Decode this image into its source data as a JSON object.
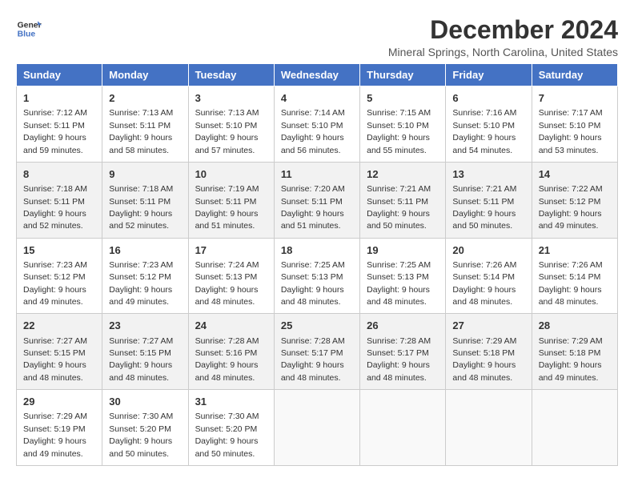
{
  "header": {
    "logo_line1": "General",
    "logo_line2": "Blue",
    "month": "December 2024",
    "location": "Mineral Springs, North Carolina, United States"
  },
  "weekdays": [
    "Sunday",
    "Monday",
    "Tuesday",
    "Wednesday",
    "Thursday",
    "Friday",
    "Saturday"
  ],
  "weeks": [
    [
      {
        "day": 1,
        "sunrise": "7:12 AM",
        "sunset": "5:11 PM",
        "daylight": "9 hours and 59 minutes."
      },
      {
        "day": 2,
        "sunrise": "7:13 AM",
        "sunset": "5:11 PM",
        "daylight": "9 hours and 58 minutes."
      },
      {
        "day": 3,
        "sunrise": "7:13 AM",
        "sunset": "5:10 PM",
        "daylight": "9 hours and 57 minutes."
      },
      {
        "day": 4,
        "sunrise": "7:14 AM",
        "sunset": "5:10 PM",
        "daylight": "9 hours and 56 minutes."
      },
      {
        "day": 5,
        "sunrise": "7:15 AM",
        "sunset": "5:10 PM",
        "daylight": "9 hours and 55 minutes."
      },
      {
        "day": 6,
        "sunrise": "7:16 AM",
        "sunset": "5:10 PM",
        "daylight": "9 hours and 54 minutes."
      },
      {
        "day": 7,
        "sunrise": "7:17 AM",
        "sunset": "5:10 PM",
        "daylight": "9 hours and 53 minutes."
      }
    ],
    [
      {
        "day": 8,
        "sunrise": "7:18 AM",
        "sunset": "5:11 PM",
        "daylight": "9 hours and 52 minutes."
      },
      {
        "day": 9,
        "sunrise": "7:18 AM",
        "sunset": "5:11 PM",
        "daylight": "9 hours and 52 minutes."
      },
      {
        "day": 10,
        "sunrise": "7:19 AM",
        "sunset": "5:11 PM",
        "daylight": "9 hours and 51 minutes."
      },
      {
        "day": 11,
        "sunrise": "7:20 AM",
        "sunset": "5:11 PM",
        "daylight": "9 hours and 51 minutes."
      },
      {
        "day": 12,
        "sunrise": "7:21 AM",
        "sunset": "5:11 PM",
        "daylight": "9 hours and 50 minutes."
      },
      {
        "day": 13,
        "sunrise": "7:21 AM",
        "sunset": "5:11 PM",
        "daylight": "9 hours and 50 minutes."
      },
      {
        "day": 14,
        "sunrise": "7:22 AM",
        "sunset": "5:12 PM",
        "daylight": "9 hours and 49 minutes."
      }
    ],
    [
      {
        "day": 15,
        "sunrise": "7:23 AM",
        "sunset": "5:12 PM",
        "daylight": "9 hours and 49 minutes."
      },
      {
        "day": 16,
        "sunrise": "7:23 AM",
        "sunset": "5:12 PM",
        "daylight": "9 hours and 49 minutes."
      },
      {
        "day": 17,
        "sunrise": "7:24 AM",
        "sunset": "5:13 PM",
        "daylight": "9 hours and 48 minutes."
      },
      {
        "day": 18,
        "sunrise": "7:25 AM",
        "sunset": "5:13 PM",
        "daylight": "9 hours and 48 minutes."
      },
      {
        "day": 19,
        "sunrise": "7:25 AM",
        "sunset": "5:13 PM",
        "daylight": "9 hours and 48 minutes."
      },
      {
        "day": 20,
        "sunrise": "7:26 AM",
        "sunset": "5:14 PM",
        "daylight": "9 hours and 48 minutes."
      },
      {
        "day": 21,
        "sunrise": "7:26 AM",
        "sunset": "5:14 PM",
        "daylight": "9 hours and 48 minutes."
      }
    ],
    [
      {
        "day": 22,
        "sunrise": "7:27 AM",
        "sunset": "5:15 PM",
        "daylight": "9 hours and 48 minutes."
      },
      {
        "day": 23,
        "sunrise": "7:27 AM",
        "sunset": "5:15 PM",
        "daylight": "9 hours and 48 minutes."
      },
      {
        "day": 24,
        "sunrise": "7:28 AM",
        "sunset": "5:16 PM",
        "daylight": "9 hours and 48 minutes."
      },
      {
        "day": 25,
        "sunrise": "7:28 AM",
        "sunset": "5:17 PM",
        "daylight": "9 hours and 48 minutes."
      },
      {
        "day": 26,
        "sunrise": "7:28 AM",
        "sunset": "5:17 PM",
        "daylight": "9 hours and 48 minutes."
      },
      {
        "day": 27,
        "sunrise": "7:29 AM",
        "sunset": "5:18 PM",
        "daylight": "9 hours and 48 minutes."
      },
      {
        "day": 28,
        "sunrise": "7:29 AM",
        "sunset": "5:18 PM",
        "daylight": "9 hours and 49 minutes."
      }
    ],
    [
      {
        "day": 29,
        "sunrise": "7:29 AM",
        "sunset": "5:19 PM",
        "daylight": "9 hours and 49 minutes."
      },
      {
        "day": 30,
        "sunrise": "7:30 AM",
        "sunset": "5:20 PM",
        "daylight": "9 hours and 50 minutes."
      },
      {
        "day": 31,
        "sunrise": "7:30 AM",
        "sunset": "5:20 PM",
        "daylight": "9 hours and 50 minutes."
      },
      null,
      null,
      null,
      null
    ]
  ]
}
